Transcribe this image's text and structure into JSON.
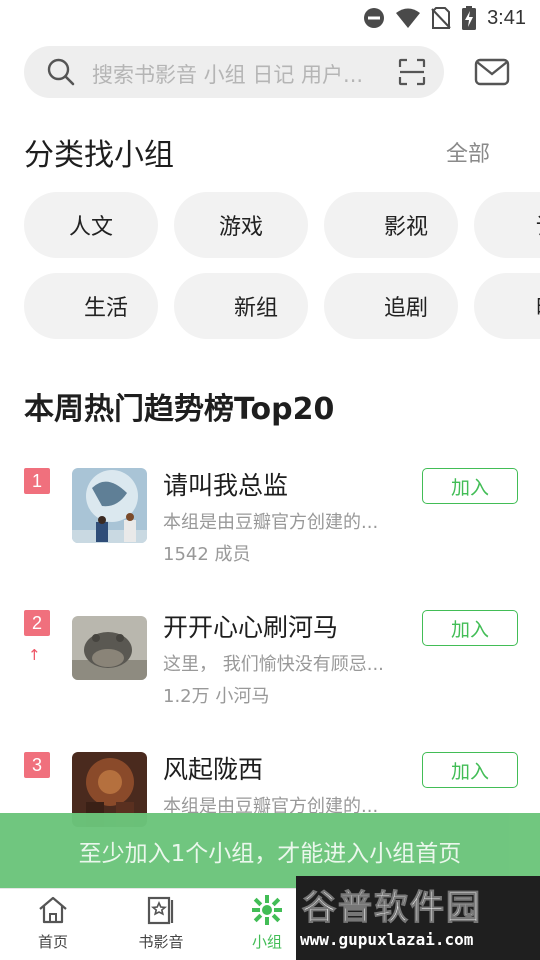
{
  "status_bar": {
    "time": "3:41",
    "icons": [
      "do-not-disturb-icon",
      "wifi-icon",
      "no-sim-icon",
      "battery-charging-icon"
    ]
  },
  "search": {
    "placeholder": "搜索书影音 小组 日记 用户..."
  },
  "category_section": {
    "title": "分类找小组",
    "all_label": "全部",
    "row1": [
      "人文",
      "游戏",
      "影视",
      "读"
    ],
    "row2": [
      "生活",
      "新组",
      "追剧",
      "时"
    ]
  },
  "trending": {
    "title": "本周热门趋势榜Top20",
    "groups": [
      {
        "rank": "1",
        "name": "请叫我总监",
        "desc": "本组是由豆瓣官方创建的...",
        "members": "1542 成员",
        "join_label": "加入",
        "trend": ""
      },
      {
        "rank": "2",
        "name": "开开心心刷河马",
        "desc": "这里， 我们愉快没有顾忌...",
        "members": "1.2万 小河马",
        "join_label": "加入",
        "trend": "↑"
      },
      {
        "rank": "3",
        "name": "风起陇西",
        "desc": "本组是由豆瓣官方创建的...",
        "members": "",
        "join_label": "加入",
        "trend": ""
      }
    ]
  },
  "toast": {
    "message": "至少加入1个小组，才能进入小组首页"
  },
  "bottom_nav": {
    "items": [
      {
        "label": "首页",
        "icon": "home-icon"
      },
      {
        "label": "书影音",
        "icon": "book-movie-icon"
      },
      {
        "label": "小组",
        "icon": "group-icon"
      }
    ],
    "active": "小组"
  },
  "watermark": {
    "main": "谷普软件园",
    "url": "www.gupuxlazai.com"
  },
  "colors": {
    "accent": "#42bd56",
    "rank_badge": "#f0707d",
    "toast_bg": "#6cc57b"
  }
}
